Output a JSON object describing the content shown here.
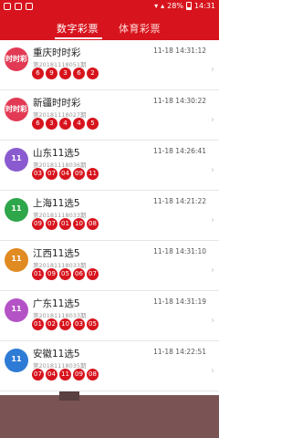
{
  "status_bar": {
    "battery": "28%",
    "time": "14:31"
  },
  "tabs": [
    {
      "label": "数字彩票"
    },
    {
      "label": "体育彩票"
    }
  ],
  "rows": [
    {
      "title": "重庆时时彩",
      "issue": "第20181118051期",
      "time": "11-18 14:31:12",
      "logo_text": "时时彩",
      "logo_color": "#e23a54",
      "numbers": [
        "6",
        "9",
        "3",
        "6",
        "2"
      ]
    },
    {
      "title": "新疆时时彩",
      "issue": "第20181118027期",
      "time": "11-18 14:30:22",
      "logo_text": "时时彩",
      "logo_color": "#e23a54",
      "numbers": [
        "6",
        "3",
        "4",
        "4",
        "5"
      ]
    },
    {
      "title": "山东11选5",
      "issue": "第20181118036期",
      "time": "11-18 14:26:41",
      "logo_text": "11",
      "logo_color": "#8a5ad0",
      "numbers": [
        "03",
        "07",
        "04",
        "09",
        "11"
      ]
    },
    {
      "title": "上海11选5",
      "issue": "第20181118033期",
      "time": "11-18 14:21:22",
      "logo_text": "11",
      "logo_color": "#2ea64a",
      "numbers": [
        "09",
        "07",
        "01",
        "10",
        "08"
      ]
    },
    {
      "title": "江西11选5",
      "issue": "第20181118033期",
      "time": "11-18 14:31:10",
      "logo_text": "11",
      "logo_color": "#e08a22",
      "numbers": [
        "01",
        "09",
        "05",
        "06",
        "07"
      ]
    },
    {
      "title": "广东11选5",
      "issue": "第20181118033期",
      "time": "11-18 14:31:19",
      "logo_text": "11",
      "logo_color": "#b453c6",
      "numbers": [
        "01",
        "02",
        "10",
        "03",
        "05"
      ]
    },
    {
      "title": "安徽11选5",
      "issue": "第20181118035期",
      "time": "11-18 14:22:51",
      "logo_text": "11",
      "logo_color": "#2e7bd6",
      "numbers": [
        "07",
        "04",
        "11",
        "09",
        "08"
      ]
    }
  ]
}
